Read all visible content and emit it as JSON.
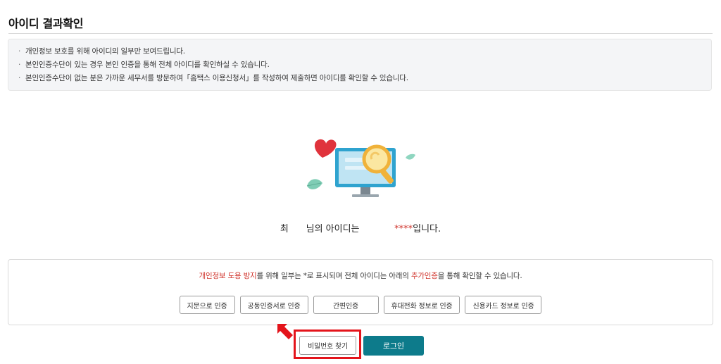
{
  "header": {
    "title": "아이디 결과확인"
  },
  "notice": {
    "items": [
      "개인정보 보호를 위해 아이디의 일부만 보여드립니다.",
      "본인인증수단이 있는 경우 본인 인증을 통해 전체 아이디를 확인하실 수 있습니다.",
      "본인인증수단이 없는 분은 가까운 세무서를 방문하여「홈택스 이용신청서」를 작성하여 제출하면 아이디를 확인할 수 있습니다."
    ]
  },
  "result": {
    "name": "최",
    "suffix": "님의 아이디는",
    "masked_id": "****",
    "ending": "입니다."
  },
  "auth": {
    "desc_highlight1": "개인정보 도용 방지",
    "desc_part2": "를 위해 일부는 *로 표시되며 전체 아이디는 아래의 ",
    "desc_highlight2": "추가인증",
    "desc_part3": "을 통해 확인할 수 있습니다.",
    "buttons": [
      "지문으로 인증",
      "공동인증서로 인증",
      "간편인증",
      "휴대전화 정보로 인증",
      "신용카드 정보로 인증"
    ]
  },
  "actions": {
    "find_password": "비밀번호 찾기",
    "login": "로그인"
  },
  "colors": {
    "accent": "#0d7b8b",
    "highlight": "#d0342c",
    "frame": "#e4141b"
  },
  "icons": [
    "monitor-magnifier-illustration",
    "heart-icon",
    "leaf-icon",
    "arrow-pointer-icon"
  ]
}
